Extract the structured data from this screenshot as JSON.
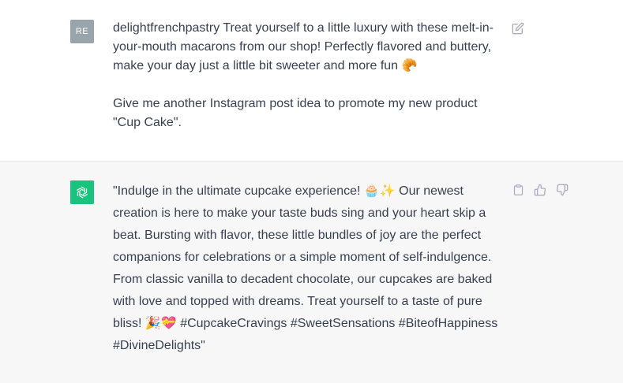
{
  "user_message": {
    "avatar_initials": "RE",
    "avatar_color": "#9aa5ab",
    "paragraph1": "delightfrenchpastry Treat yourself to a little luxury with these melt-in-your-mouth macarons from our shop! Perfectly flavored and buttery, make your day just a little bit sweeter and more fun 🥐",
    "paragraph2": "Give me another Instagram post idea to promote my new product \"Cup Cake\"."
  },
  "assistant_message": {
    "avatar_color": "#19c37d",
    "text": "\"Indulge in the ultimate cupcake experience! 🧁✨ Our newest creation is here to make your taste buds sing and your heart skip a beat. Bursting with flavor, these little bundles of joy are the perfect companions for celebrations or a simple moment of self-indulgence. From classic vanilla to decadent chocolate, our cupcakes are baked with love and topped with dreams. Treat yourself to a taste of pure bliss! 🎉💝 #CupcakeCravings #SweetSensations #BiteofHappiness #DivineDelights\""
  },
  "icons": {
    "edit": "edit-icon",
    "copy": "clipboard-icon",
    "like": "thumbs-up-icon",
    "dislike": "thumbs-down-icon",
    "bot": "openai-logo-icon"
  }
}
